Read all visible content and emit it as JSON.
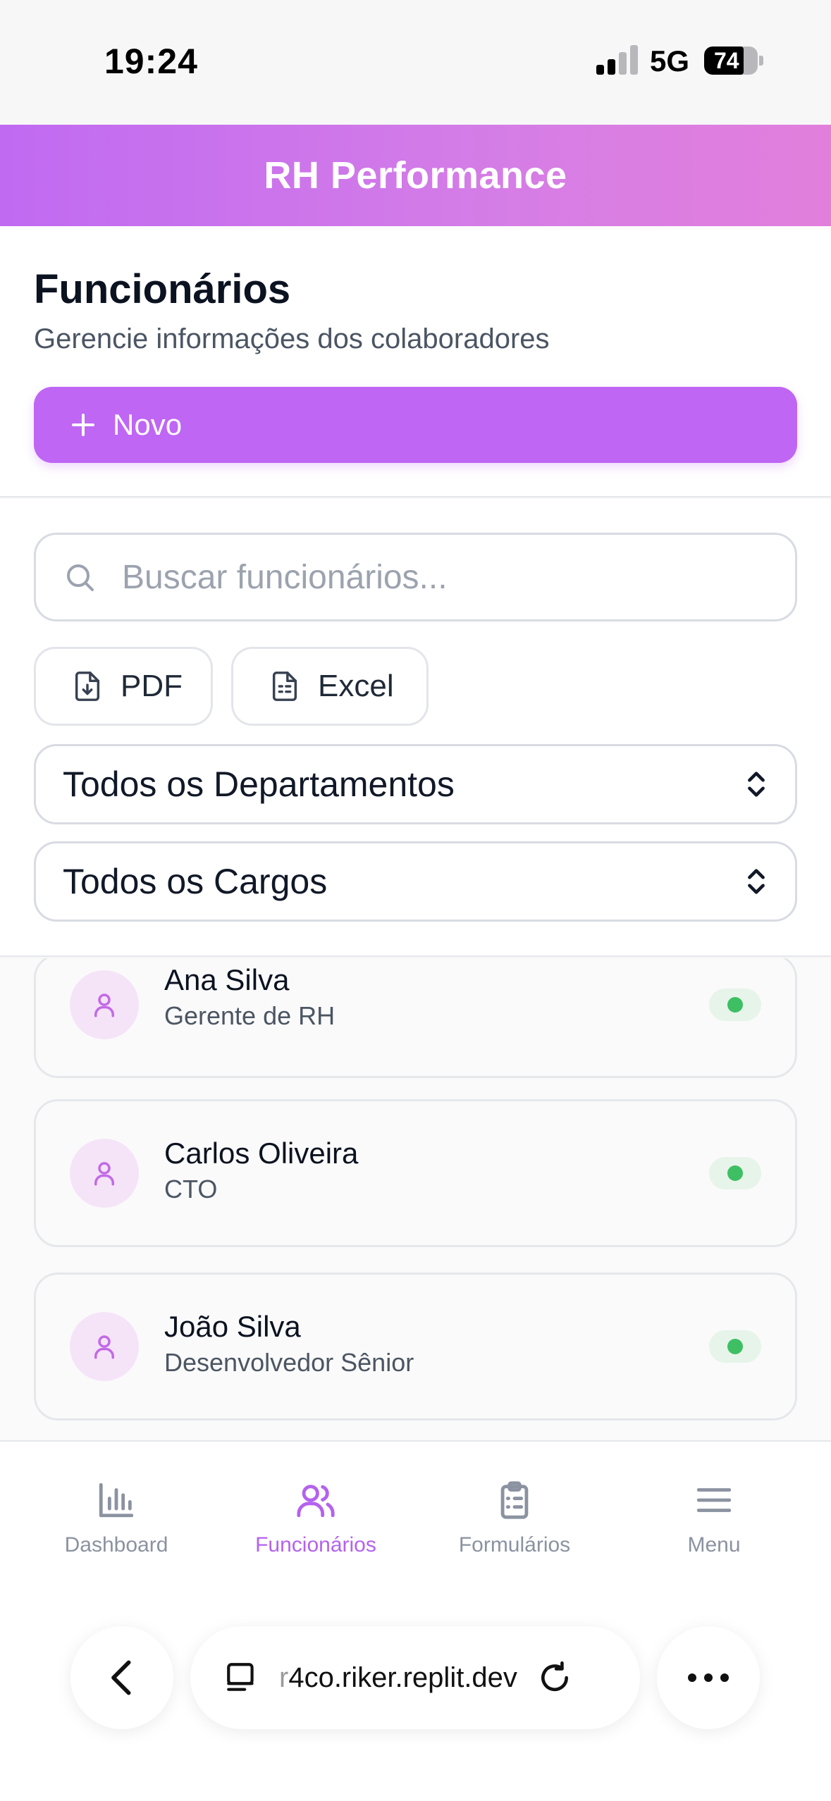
{
  "status_bar": {
    "time": "19:24",
    "network": "5G",
    "battery": "74",
    "battery_level": 0.74
  },
  "app": {
    "title": "RH Performance"
  },
  "page": {
    "title": "Funcionários",
    "subtitle": "Gerencie informações dos colaboradores",
    "new_button": "Novo"
  },
  "filters": {
    "search_placeholder": "Buscar funcionários...",
    "export_pdf": "PDF",
    "export_excel": "Excel",
    "department_select": "Todos os Departamentos",
    "role_select": "Todos os Cargos"
  },
  "employees": [
    {
      "name": "Ana Silva",
      "role": "Gerente de RH",
      "status": "active"
    },
    {
      "name": "Carlos Oliveira",
      "role": "CTO",
      "status": "active"
    },
    {
      "name": "João Silva",
      "role": "Desenvolvedor Sênior",
      "status": "active"
    }
  ],
  "tabs": [
    {
      "label": "Dashboard",
      "icon": "bar-chart-icon",
      "active": false
    },
    {
      "label": "Funcionários",
      "icon": "users-icon",
      "active": true
    },
    {
      "label": "Formulários",
      "icon": "clipboard-icon",
      "active": false
    },
    {
      "label": "Menu",
      "icon": "menu-icon",
      "active": false
    }
  ],
  "browser": {
    "url_faded": "r",
    "url": "4co.riker.replit.dev"
  },
  "colors": {
    "accent": "#bf66f4",
    "header_start": "#c06af2",
    "header_end": "#e27fdc",
    "status_active": "#3fbf63"
  }
}
